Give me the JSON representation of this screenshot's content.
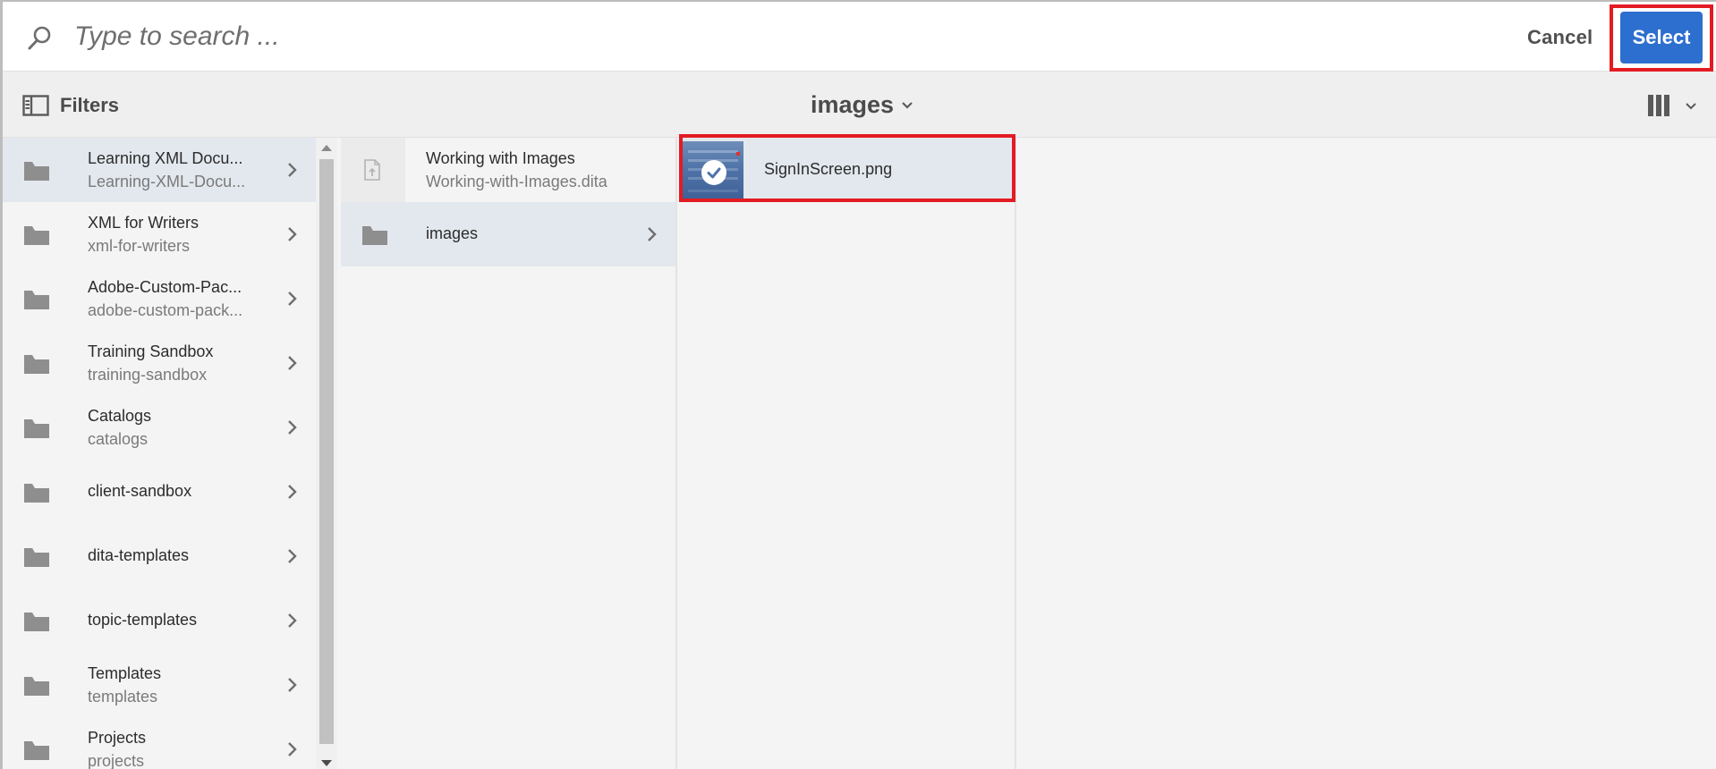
{
  "search": {
    "placeholder": "Type to search ...",
    "cancel_label": "Cancel",
    "select_label": "Select"
  },
  "toolbar": {
    "filters_label": "Filters",
    "folder_title": "images"
  },
  "colors": {
    "accent": "#2d6fcf",
    "highlight": "#e31b23",
    "selected_row": "#e3e8ee"
  },
  "column1": {
    "items": [
      {
        "name": "Learning XML Docu...",
        "sub": "Learning-XML-Docu...",
        "icon": "folder-icon"
      },
      {
        "name": "XML for Writers",
        "sub": "xml-for-writers",
        "icon": "folder-icon"
      },
      {
        "name": "Adobe-Custom-Pac...",
        "sub": "adobe-custom-pack...",
        "icon": "folder-icon"
      },
      {
        "name": "Training Sandbox",
        "sub": "training-sandbox",
        "icon": "folder-icon"
      },
      {
        "name": "Catalogs",
        "sub": "catalogs",
        "icon": "folder-icon"
      },
      {
        "name": "client-sandbox",
        "sub": "",
        "icon": "folder-icon"
      },
      {
        "name": "dita-templates",
        "sub": "",
        "icon": "folder-icon"
      },
      {
        "name": "topic-templates",
        "sub": "",
        "icon": "folder-icon"
      },
      {
        "name": "Templates",
        "sub": "templates",
        "icon": "folder-icon"
      },
      {
        "name": "Projects",
        "sub": "projects",
        "icon": "folder-icon"
      }
    ]
  },
  "column2": {
    "items": [
      {
        "name": "Working with Images",
        "sub": "Working-with-Images.dita",
        "icon": "file-icon"
      },
      {
        "name": "images",
        "sub": "",
        "icon": "folder-icon"
      }
    ]
  },
  "column3": {
    "items": [
      {
        "name": "SignInScreen.png",
        "icon": "image-thumbnail"
      }
    ]
  }
}
